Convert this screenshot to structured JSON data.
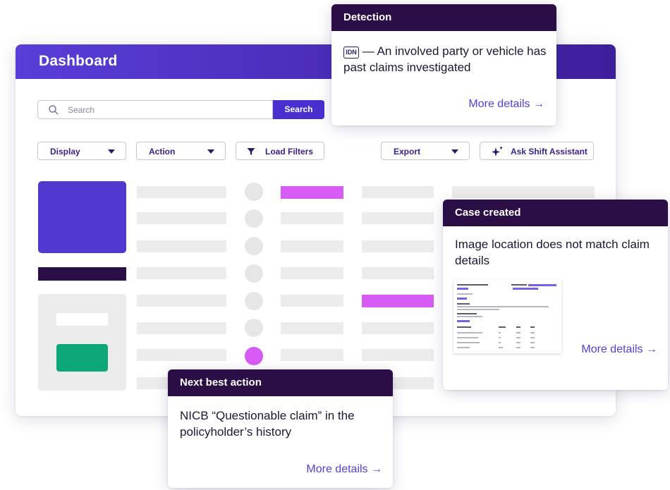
{
  "dashboard": {
    "title": "Dashboard",
    "search": {
      "placeholder": "Search",
      "button_label": "Search"
    },
    "toolbar": {
      "display_label": "Display",
      "action_label": "Action",
      "load_filters_label": "Load Filters",
      "export_label": "Export",
      "assistant_label": "Ask Shift Assistant"
    }
  },
  "cards": {
    "detection": {
      "title": "Detection",
      "badge": "IDN",
      "text": "— An involved party or vehicle has past claims investigated",
      "link": "More details →"
    },
    "case_created": {
      "title": "Case created",
      "text": "Image location does not match claim details",
      "link": "More details →"
    },
    "next_best_action": {
      "title": "Next best action",
      "text": "NICB “Questionable claim” in the policyholder’s history",
      "link": "More details →"
    }
  },
  "colors": {
    "header_gradient_start": "#5a3dd8",
    "header_gradient_end": "#3d1f9c",
    "card_header": "#2a0e45",
    "accent_purple": "#5038d0",
    "highlight_magenta": "#d65cf5",
    "success_green": "#0ca679",
    "link": "#5a3dd8"
  },
  "icons": {
    "search": "search-icon",
    "caret": "caret-down-icon",
    "filter": "filter-icon",
    "sparkle": "sparkle-icon",
    "arrow": "arrow-right-icon"
  }
}
